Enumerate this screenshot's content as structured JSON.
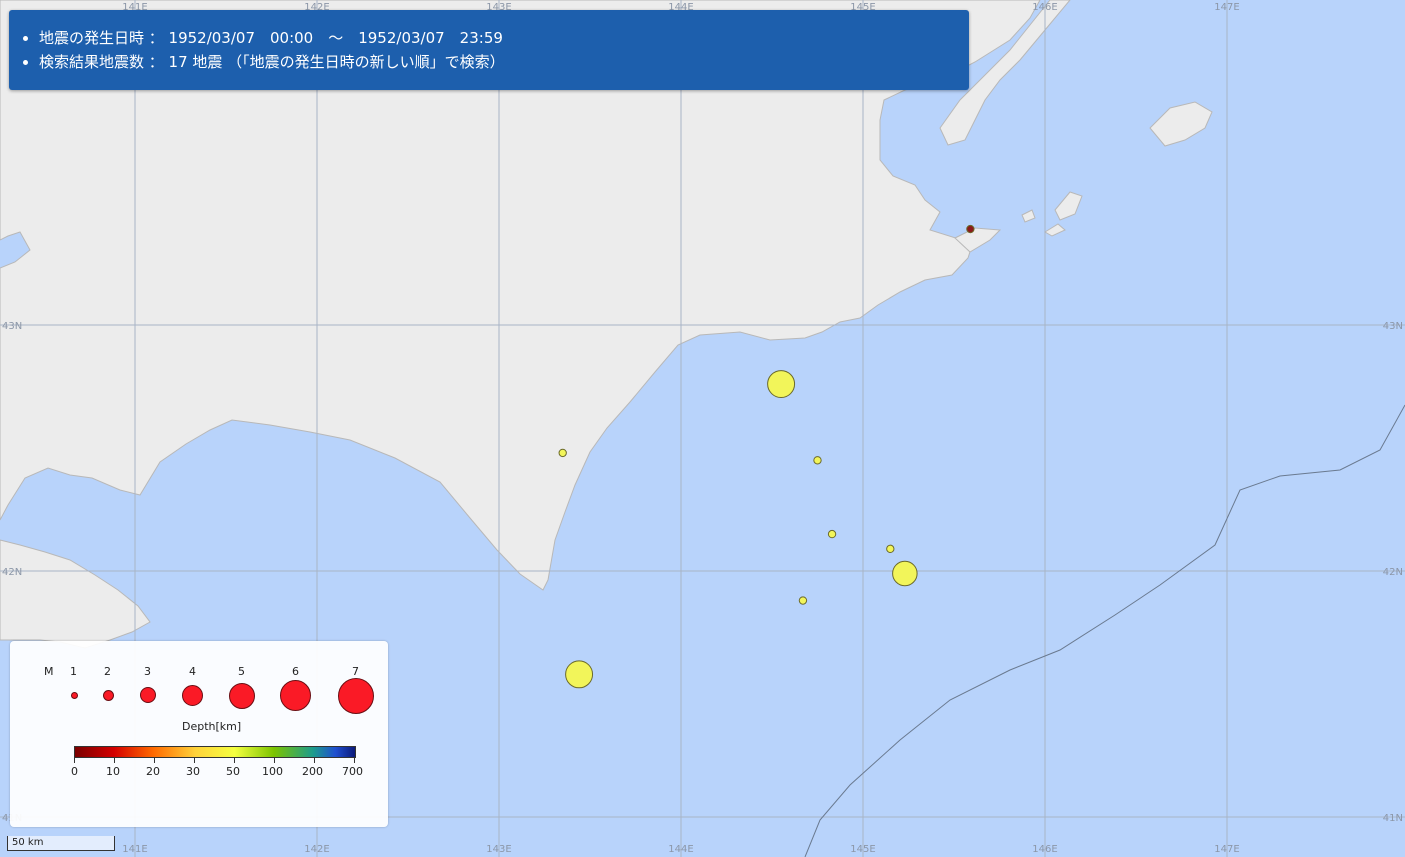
{
  "banner": {
    "line1": "地震の発生日時 ： 1952/03/07　00:00　～　1952/03/07　23:59",
    "line2": "検索結果地震数 ： 17 地震 （「地震の発生日時の新しい順」で検索）"
  },
  "map": {
    "longitude_labels": [
      "141E",
      "142E",
      "143E",
      "144E",
      "145E",
      "146E",
      "147E"
    ],
    "latitude_labels": [
      "43N",
      "42N",
      "41N"
    ],
    "colors": {
      "sea": "#b8d3fb",
      "land": "#ececec",
      "grid": "#a8b4c6",
      "quake_shallow": "#f2f55a",
      "quake_deep": "#8b1a1a"
    },
    "earthquakes": [
      {
        "lon": 145.59,
        "lat": 43.39,
        "magnitude": 1.5,
        "depth_km": 5,
        "color": "#8b1a1a"
      },
      {
        "lon": 144.55,
        "lat": 42.76,
        "magnitude": 5.5,
        "depth_km": 40,
        "color": "#f2f55a"
      },
      {
        "lon": 143.35,
        "lat": 42.48,
        "magnitude": 1.5,
        "depth_km": 40,
        "color": "#f2f55a"
      },
      {
        "lon": 144.75,
        "lat": 42.45,
        "magnitude": 1.5,
        "depth_km": 40,
        "color": "#f2f55a"
      },
      {
        "lon": 144.83,
        "lat": 42.15,
        "magnitude": 1.5,
        "depth_km": 40,
        "color": "#f2f55a"
      },
      {
        "lon": 145.15,
        "lat": 42.09,
        "magnitude": 1.5,
        "depth_km": 40,
        "color": "#f2f55a"
      },
      {
        "lon": 145.23,
        "lat": 41.99,
        "magnitude": 5.0,
        "depth_km": 40,
        "color": "#f2f55a"
      },
      {
        "lon": 144.67,
        "lat": 41.88,
        "magnitude": 1.5,
        "depth_km": 40,
        "color": "#f2f55a"
      },
      {
        "lon": 143.44,
        "lat": 41.58,
        "magnitude": 5.5,
        "depth_km": 40,
        "color": "#f2f55a"
      }
    ]
  },
  "legend": {
    "m_label": "M",
    "magnitudes": [
      "1",
      "2",
      "3",
      "4",
      "5",
      "6",
      "7"
    ],
    "depth_title": "Depth[km]",
    "depth_ticks": [
      "0",
      "10",
      "20",
      "30",
      "50",
      "100",
      "200",
      "700"
    ],
    "circle_color": "#fa1a26"
  },
  "scale_bar": {
    "label": "50 km"
  }
}
